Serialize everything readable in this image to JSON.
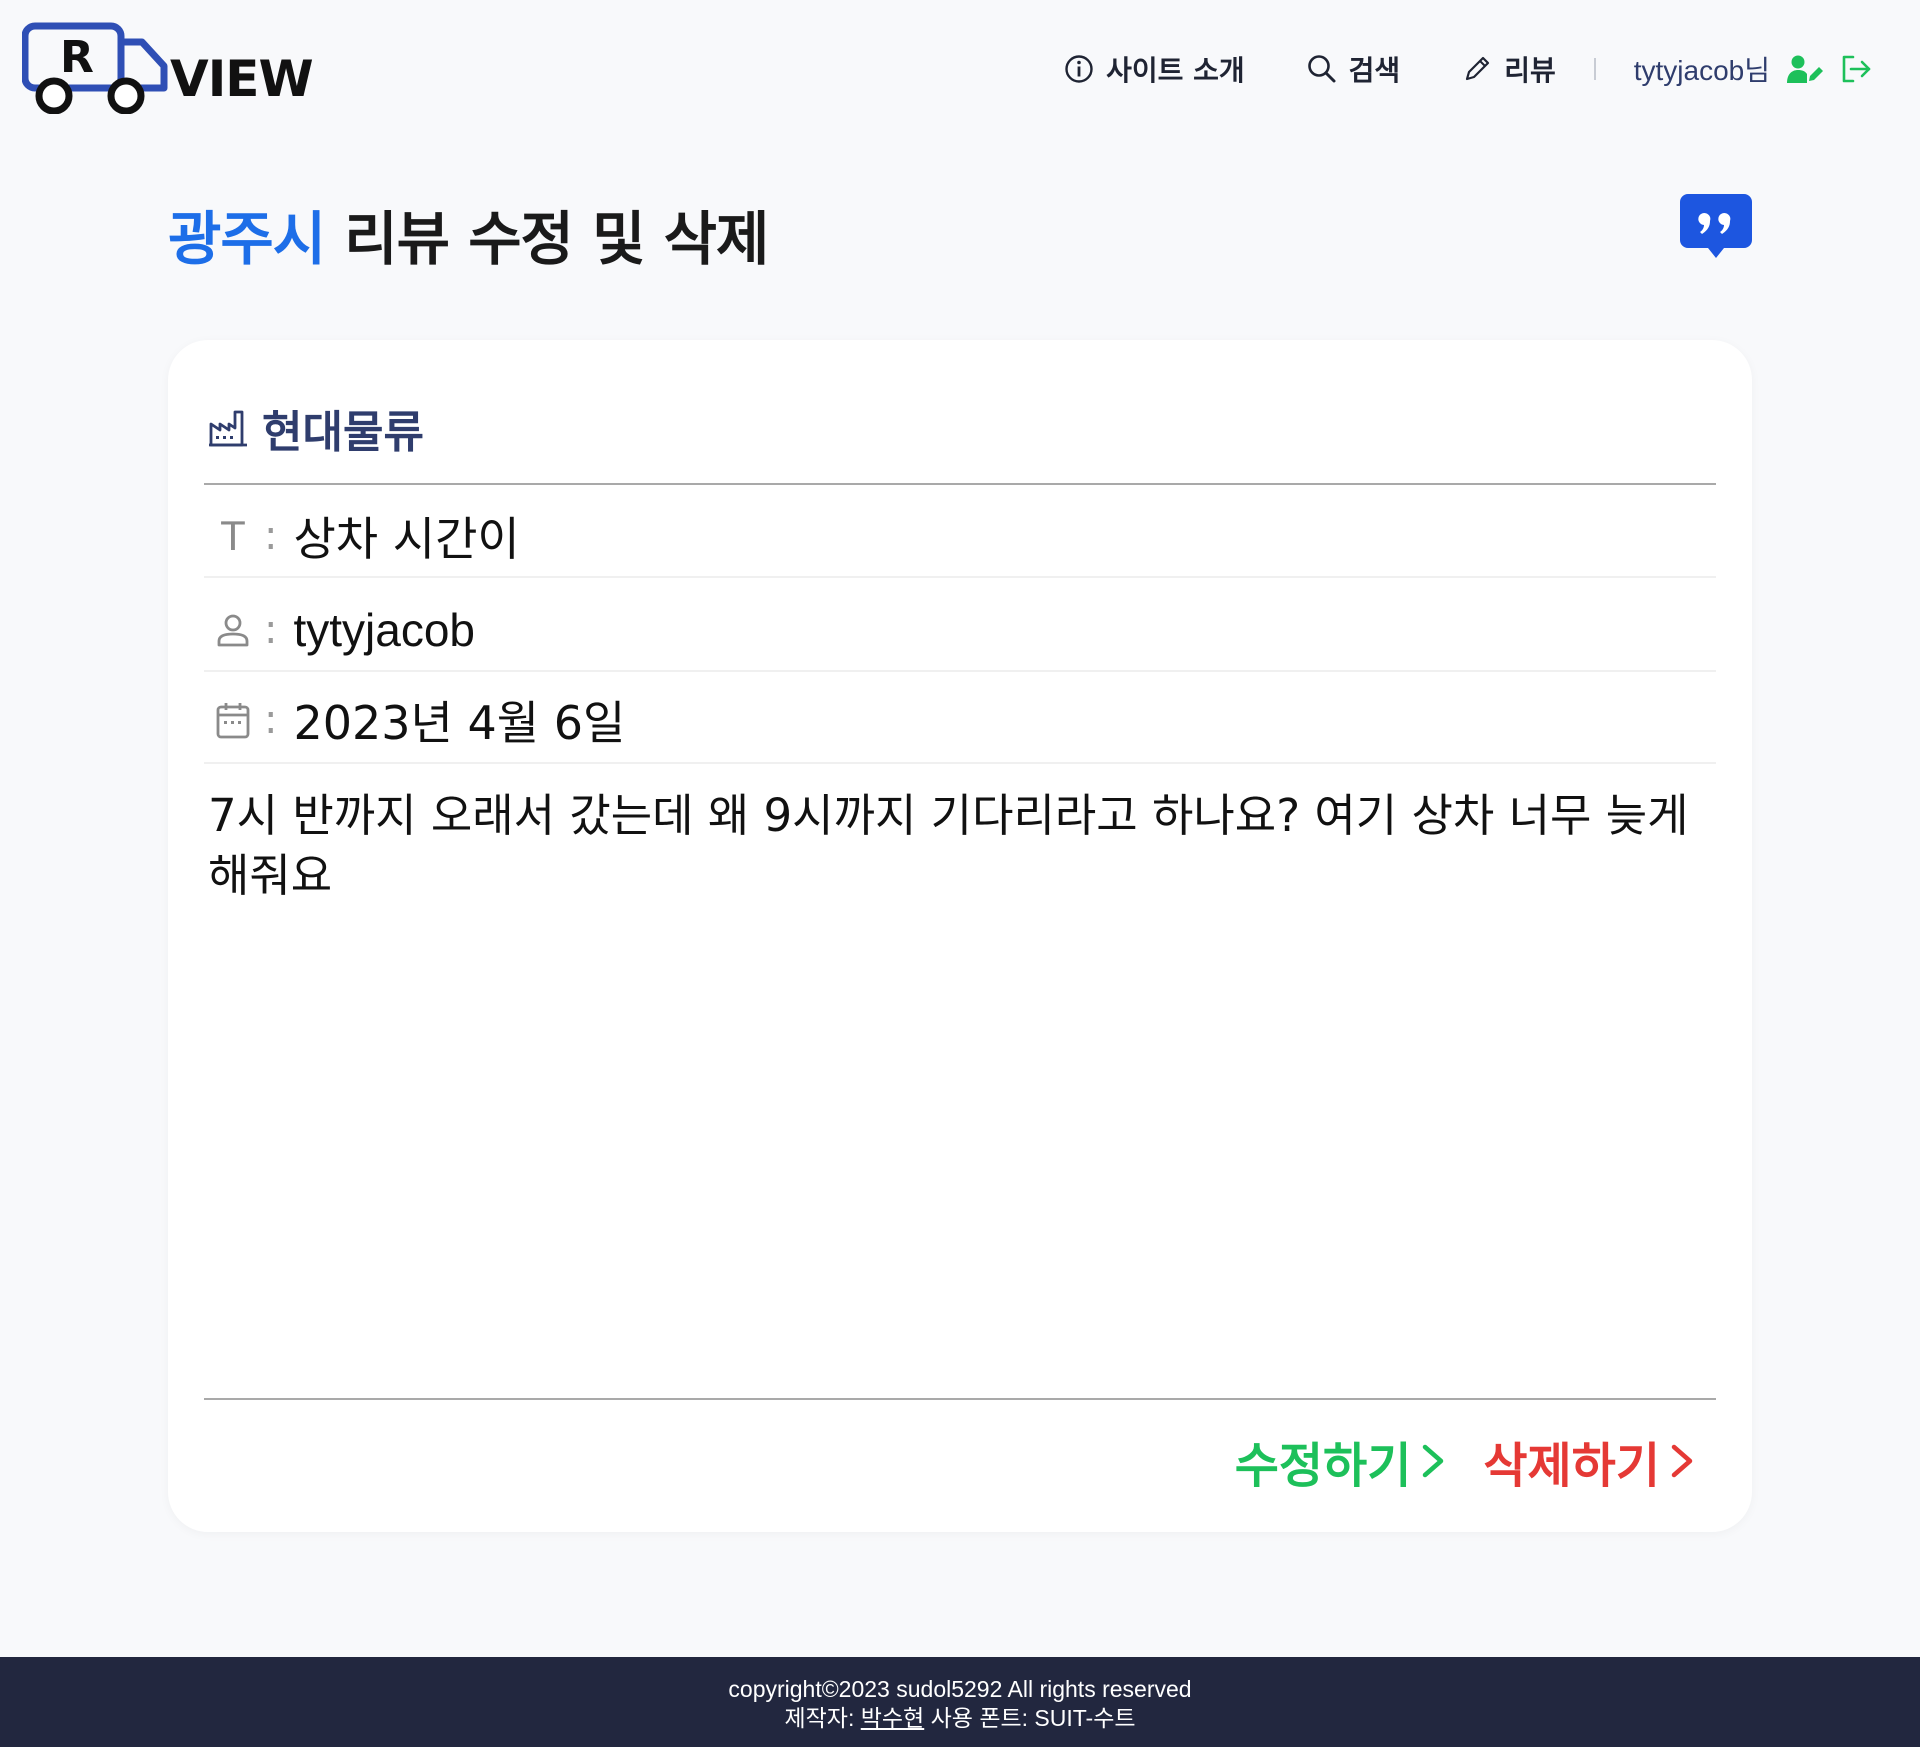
{
  "header": {
    "logo_letter": "R",
    "logo_word": "VIEW",
    "nav": [
      {
        "label": "사이트 소개",
        "icon": "info-icon"
      },
      {
        "label": "검색",
        "icon": "search-icon"
      },
      {
        "label": "리뷰",
        "icon": "pencil-icon"
      }
    ],
    "username": "tytyjacob님",
    "user_icon": "user-edit-icon",
    "logout_icon": "logout-icon"
  },
  "page": {
    "city": "광주시",
    "title_rest": " 리뷰 수정 및 삭제",
    "badge_icon": "quote-icon"
  },
  "review": {
    "company_icon": "factory-icon",
    "company": "현대물류",
    "title_icon": "text-icon",
    "title_label": "T",
    "title": "상차 시간이",
    "author_icon": "user-icon",
    "author": "tytyjacob",
    "date_icon": "calendar-icon",
    "date": "2023년 4월 6일",
    "content": "7시 반까지 오래서 갔는데 왜 9시까지 기다리라고 하나요? 여기 상차 너무 늦게 해줘요",
    "edit_label": "수정하기",
    "delete_label": "삭제하기"
  },
  "footer": {
    "line1": "copyright©2023 sudol5292 All rights reserved",
    "maker_prefix": "제작자: ",
    "maker_name": "박수현",
    "font_note": " 사용 폰트: SUIT-수트"
  },
  "colors": {
    "accent_blue": "#1d6ee8",
    "navy": "#2f3d6d",
    "edit_green": "#1dc05a",
    "delete_red": "#e53935",
    "footer_bg": "#22273f"
  }
}
